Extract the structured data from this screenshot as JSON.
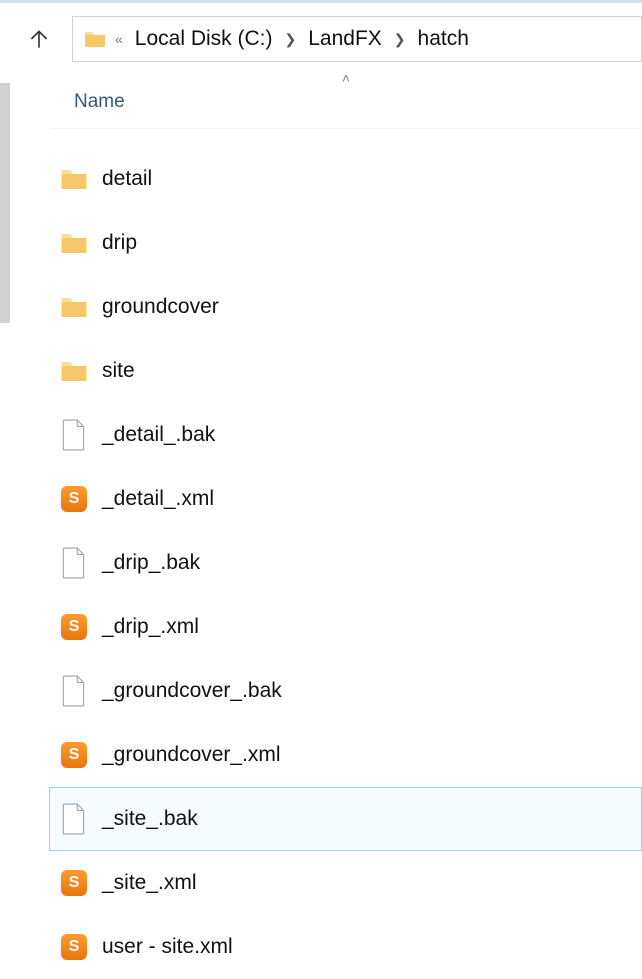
{
  "breadcrumbs": {
    "root": "Local Disk (C:)",
    "p1": "LandFX",
    "p2": "hatch"
  },
  "columns": {
    "name": "Name"
  },
  "files": [
    {
      "name": "detail",
      "type": "folder",
      "selected": false
    },
    {
      "name": "drip",
      "type": "folder",
      "selected": false
    },
    {
      "name": "groundcover",
      "type": "folder",
      "selected": false
    },
    {
      "name": "site",
      "type": "folder",
      "selected": false
    },
    {
      "name": "_detail_.bak",
      "type": "bak",
      "selected": false
    },
    {
      "name": "_detail_.xml",
      "type": "xml",
      "selected": false
    },
    {
      "name": "_drip_.bak",
      "type": "bak",
      "selected": false
    },
    {
      "name": "_drip_.xml",
      "type": "xml",
      "selected": false
    },
    {
      "name": "_groundcover_.bak",
      "type": "bak",
      "selected": false
    },
    {
      "name": "_groundcover_.xml",
      "type": "xml",
      "selected": false
    },
    {
      "name": "_site_.bak",
      "type": "bak",
      "selected": true
    },
    {
      "name": "_site_.xml",
      "type": "xml",
      "selected": false
    },
    {
      "name": "user - site.xml",
      "type": "xml",
      "selected": false
    }
  ],
  "icon_glyph": {
    "xml": "S"
  }
}
